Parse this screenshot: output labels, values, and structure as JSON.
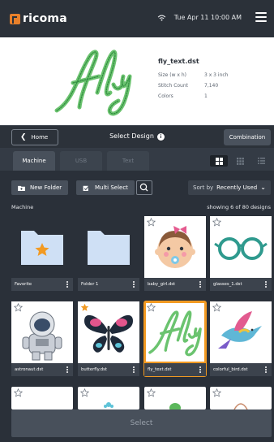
{
  "header": {
    "logo_text": "ricoma",
    "datetime": "Tue Apr 11  10:00 AM",
    "icons": [
      "wifi-icon",
      "hamburger-menu-icon"
    ]
  },
  "preview": {
    "art_text": "fly",
    "file_name": "fly_text.dst",
    "size_label": "Size (w x h)",
    "size_value": "3 x 3 inch",
    "stitch_label": "Stitch Count",
    "stitch_value": "7,140",
    "colors_label": "Colors",
    "colors_value": "1"
  },
  "titlebar": {
    "home_label": "Home",
    "title": "Select Design",
    "combination_label": "Combination"
  },
  "tabs": [
    {
      "label": "Machine",
      "active": true
    },
    {
      "label": "USB",
      "active": false
    },
    {
      "label": "Text",
      "active": false
    }
  ],
  "toolbar": {
    "new_folder_label": "New Folder",
    "multi_select_label": "Multi Select",
    "sort_prefix": "Sort by",
    "sort_value": "Recently Used"
  },
  "location_label": "Machine",
  "count_label": "showing 6 of 80 designs",
  "grid": [
    {
      "label": "Favorite",
      "type": "folder"
    },
    {
      "label": "Folder 1",
      "type": "folder"
    },
    {
      "label": "baby_girl.dst",
      "type": "design",
      "favorite": false
    },
    {
      "label": "glasses_1.dst",
      "type": "design",
      "favorite": false
    },
    {
      "label": "astronaut.dst",
      "type": "design",
      "favorite": false
    },
    {
      "label": "butterfly.dst",
      "type": "design",
      "favorite": true
    },
    {
      "label": "fly_text.dst",
      "type": "design",
      "favorite": false,
      "selected": true
    },
    {
      "label": "colorful_bird.dst",
      "type": "design",
      "favorite": false
    }
  ],
  "select_label": "Select",
  "colors": {
    "accent": "#f29a22",
    "logo": "#e8802a",
    "embroidery_green": "#4fb25a",
    "folder_blue": "#cfe0f5"
  }
}
